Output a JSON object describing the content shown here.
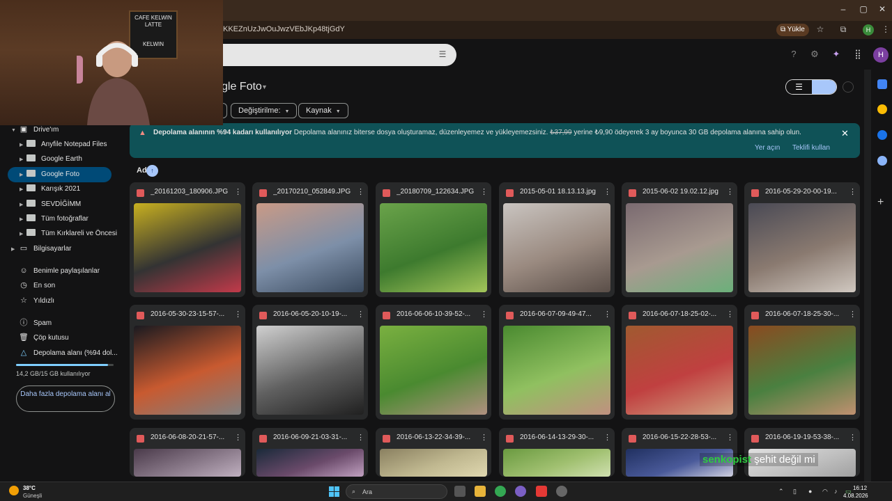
{
  "browser": {
    "url": "KKEZnUzJwOuJwzVEbJKp48tjGdY",
    "upload_label": "Yükle",
    "window_min": "–",
    "window_max": "▢",
    "window_close": "✕",
    "profile_letter": "H"
  },
  "header": {
    "avatar_letter": "H"
  },
  "page": {
    "title": "gle Foto",
    "filters": [
      "Değiştirilme:",
      "Kaynak"
    ]
  },
  "banner": {
    "bold": "Depolama alanının %94 kadarı kullanılıyor",
    "text_before_price": "Depolama alanınız biterse dosya oluşturamaz, düzenleyemez ve yükleyemezsiniz.",
    "old_price": "₺37,99",
    "text_after_price": "yerine ₺9,90 ödeyerek 3 ay boyunca 30 GB depolama alanına sahip olun.",
    "action_free": "Yer açın",
    "action_offer": "Teklifi kullan"
  },
  "sort": {
    "label": "Ad"
  },
  "sidebar": {
    "drive": "Drive'ım",
    "folders": [
      "Anyfile Notepad Files",
      "Google Earth",
      "Google Foto",
      "Karışık 2021",
      "SEVDİĞİMM",
      "Tüm fotoğraflar",
      "Tüm Kırklareli ve Öncesi"
    ],
    "computers": "Bilgisayarlar",
    "shared": "Benimle paylaşılanlar",
    "recent": "En son",
    "starred": "Yıldızlı",
    "spam": "Spam",
    "trash": "Çöp kutusu",
    "storage": "Depolama alanı (%94 dol...",
    "storage_usage": "14,2 GB/15 GB kullanılıyor",
    "storage_fraction": 0.94,
    "more_storage": "Daha fazla depolama alanı al"
  },
  "files": [
    {
      "name": "_20161203_180906.JPG",
      "colors": [
        "#c8b020",
        "#333",
        "#c23a4a"
      ]
    },
    {
      "name": "_20170210_052849.JPG",
      "colors": [
        "#c99a86",
        "#7d8fa8",
        "#3a4a5e"
      ]
    },
    {
      "name": "_20180709_122634.JPG",
      "colors": [
        "#6aa34a",
        "#3d7a2e",
        "#a3c55a"
      ]
    },
    {
      "name": "2015-05-01 18.13.13.jpg",
      "colors": [
        "#c9c4c0",
        "#9a8a80",
        "#5a4e48"
      ]
    },
    {
      "name": "2015-06-02 19.02.12.jpg",
      "colors": [
        "#7a6a70",
        "#a89a90",
        "#6bb07a"
      ]
    },
    {
      "name": "2016-05-29-20-00-19...",
      "colors": [
        "#4a4a55",
        "#8a7a70",
        "#d0c8c0"
      ]
    },
    {
      "name": "2016-05-30-23-15-57-...",
      "colors": [
        "#1a1a20",
        "#c85a30",
        "#808080"
      ]
    },
    {
      "name": "2016-06-05-20-10-19-...",
      "colors": [
        "#d0d0d0",
        "#606060",
        "#202020"
      ]
    },
    {
      "name": "2016-06-06-10-39-52-...",
      "colors": [
        "#7ab040",
        "#4a8a30",
        "#b09080"
      ]
    },
    {
      "name": "2016-06-07-09-49-47...",
      "colors": [
        "#4a8a30",
        "#90c060",
        "#c09080"
      ]
    },
    {
      "name": "2016-06-07-18-25-02-...",
      "colors": [
        "#a05a30",
        "#c04040",
        "#d0a080"
      ]
    },
    {
      "name": "2016-06-07-18-25-30-...",
      "colors": [
        "#8a4a20",
        "#4a8040",
        "#c09070"
      ]
    },
    {
      "name": "2016-06-08-20-21-57-...",
      "colors": [
        "#4a3a4a",
        "#8a7a8a",
        "#c0b0c0"
      ]
    },
    {
      "name": "2016-06-09-21-03-31-...",
      "colors": [
        "#1a2a3a",
        "#6a4a6a",
        "#c0a0c0"
      ]
    },
    {
      "name": "2016-06-13-22-34-39-...",
      "colors": [
        "#8a8060",
        "#c0b890",
        "#e0d8b0"
      ]
    },
    {
      "name": "2016-06-14-13-29-30-...",
      "colors": [
        "#6a9a40",
        "#a0c070",
        "#d0e0b0"
      ]
    },
    {
      "name": "2016-06-15-22-28-53-...",
      "colors": [
        "#203060",
        "#4a5a9a",
        "#d0d0e0"
      ]
    },
    {
      "name": "2016-06-19-19-53-38-...",
      "colors": [
        "#e0e0e0",
        "#c0c0c0",
        "#a0a0a0"
      ]
    }
  ],
  "webcam": {
    "sign_line1": "CAFE KELWIN",
    "sign_line2": "LATTE",
    "sign_line3": "KELWIN"
  },
  "subtitle": {
    "highlight": "senkopist",
    "rest": "şehit değil mi"
  },
  "taskbar": {
    "temp": "38°C",
    "weather": "Güneşli",
    "search": "Ara",
    "time": "16:12",
    "date": "4.08.2026"
  }
}
